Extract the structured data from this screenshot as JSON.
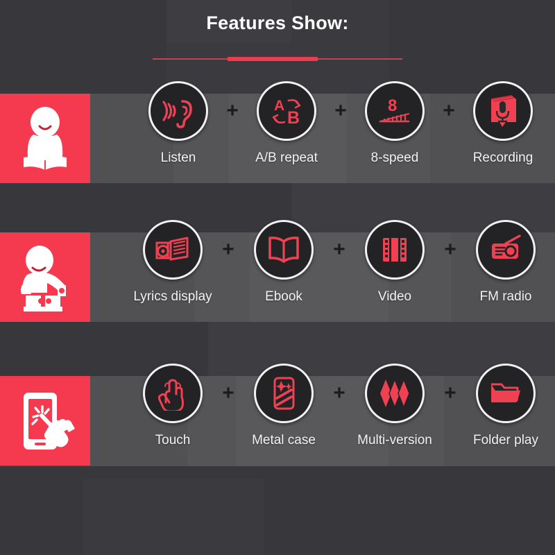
{
  "header": {
    "title": "Features Show:",
    "divider": {
      "name": "section-divider"
    }
  },
  "colors": {
    "background": "#3b3b3f",
    "band": "#555558",
    "red": "#f5394e",
    "circle_fill": "#232326",
    "circle_ring": "#f2f2f2",
    "label": "#f2f2f2",
    "plus": "#1b1b1d"
  },
  "separator": "+",
  "rows": [
    {
      "id": "row-reading",
      "panel_icon": "person-reading-book-icon",
      "features": [
        {
          "label": "Listen",
          "icon": "ear-sound-waves-icon"
        },
        {
          "label": "A/B repeat",
          "icon": "ab-repeat-arrows-icon"
        },
        {
          "label": "8-speed",
          "icon": "eight-speed-ruler-icon"
        },
        {
          "label": "Recording",
          "icon": "book-microphone-icon"
        }
      ]
    },
    {
      "id": "row-learning",
      "panel_icon": "child-puzzle-icon",
      "features": [
        {
          "label": "Lyrics display",
          "icon": "lyrics-projector-icon"
        },
        {
          "label": "Ebook",
          "icon": "open-book-icon"
        },
        {
          "label": "Video",
          "icon": "film-strip-icon"
        },
        {
          "label": "FM radio",
          "icon": "radio-antenna-icon"
        }
      ]
    },
    {
      "id": "row-hardware",
      "panel_icon": "hand-touch-phone-icon",
      "features": [
        {
          "label": "Touch",
          "icon": "touch-hand-icon"
        },
        {
          "label": "Metal case",
          "icon": "metal-phone-case-icon"
        },
        {
          "label": "Multi-version",
          "icon": "three-diamonds-icon"
        },
        {
          "label": "Folder play",
          "icon": "open-folder-icon"
        }
      ]
    }
  ]
}
